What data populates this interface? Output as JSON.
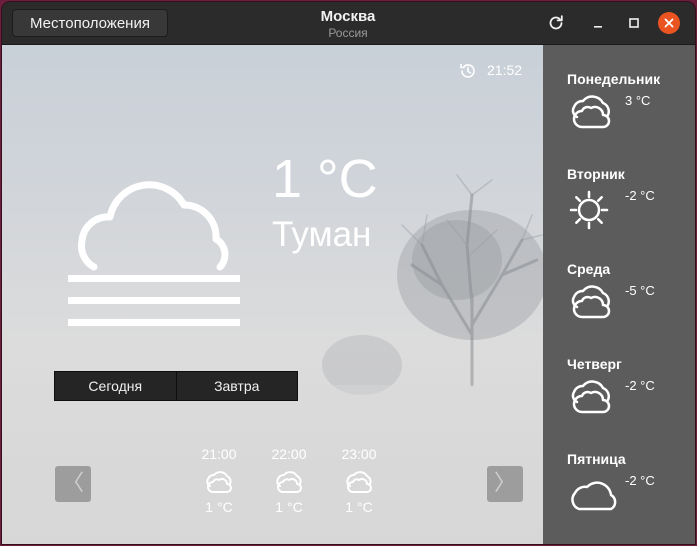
{
  "header": {
    "locations_label": "Местоположения",
    "city": "Москва",
    "country": "Россия"
  },
  "current": {
    "update_time": "21:52",
    "temperature": "1 °C",
    "condition": "Туман",
    "condition_icon": "fog-icon"
  },
  "tabs": {
    "today": "Сегодня",
    "tomorrow": "Завтра"
  },
  "nav": {
    "prev": "〈",
    "next": "〉"
  },
  "hourly": [
    {
      "time": "21:00",
      "temp": "1 °C",
      "icon": "fog-icon"
    },
    {
      "time": "22:00",
      "temp": "1 °C",
      "icon": "fog-icon"
    },
    {
      "time": "23:00",
      "temp": "1 °C",
      "icon": "fog-icon"
    }
  ],
  "daily": [
    {
      "day": "Понедельник",
      "temp": "3 °C",
      "icon": "fog-icon"
    },
    {
      "day": "Вторник",
      "temp": "-2 °C",
      "icon": "sun-icon"
    },
    {
      "day": "Среда",
      "temp": "-5 °C",
      "icon": "fog-icon"
    },
    {
      "day": "Четверг",
      "temp": "-2 °C",
      "icon": "fog-icon"
    },
    {
      "day": "Пятница",
      "temp": "-2 °C",
      "icon": "cloud-icon"
    }
  ],
  "colors": {
    "close_button": "#e95420",
    "sidebar": "#5c5c5c",
    "headerbar": "#2b2b2b"
  }
}
